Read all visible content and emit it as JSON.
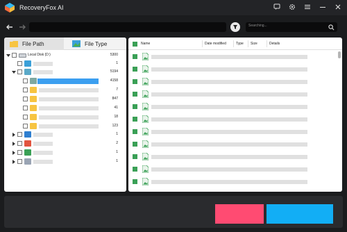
{
  "app": {
    "title": "RecoveryFox AI"
  },
  "search": {
    "placeholder": "Searching..."
  },
  "tabs": {
    "file_path": "File Path",
    "file_type": "File Type"
  },
  "tree": {
    "root_label": "Local Disk (D:)",
    "root_count": "5300",
    "counts": [
      "1",
      "5194",
      "4158",
      "7",
      "847",
      "41",
      "18",
      "123",
      "1",
      "2",
      "1",
      "1"
    ]
  },
  "columns": {
    "name": "Name",
    "date_modified": "Date modified",
    "type": "Type",
    "size": "Size",
    "details": "Details"
  },
  "colors": {
    "accent_green": "#3aa056",
    "pink_button": "#ff4b72",
    "blue_button": "#12aef5",
    "selection": "#3c9ff0",
    "folder": "#f7c441"
  }
}
